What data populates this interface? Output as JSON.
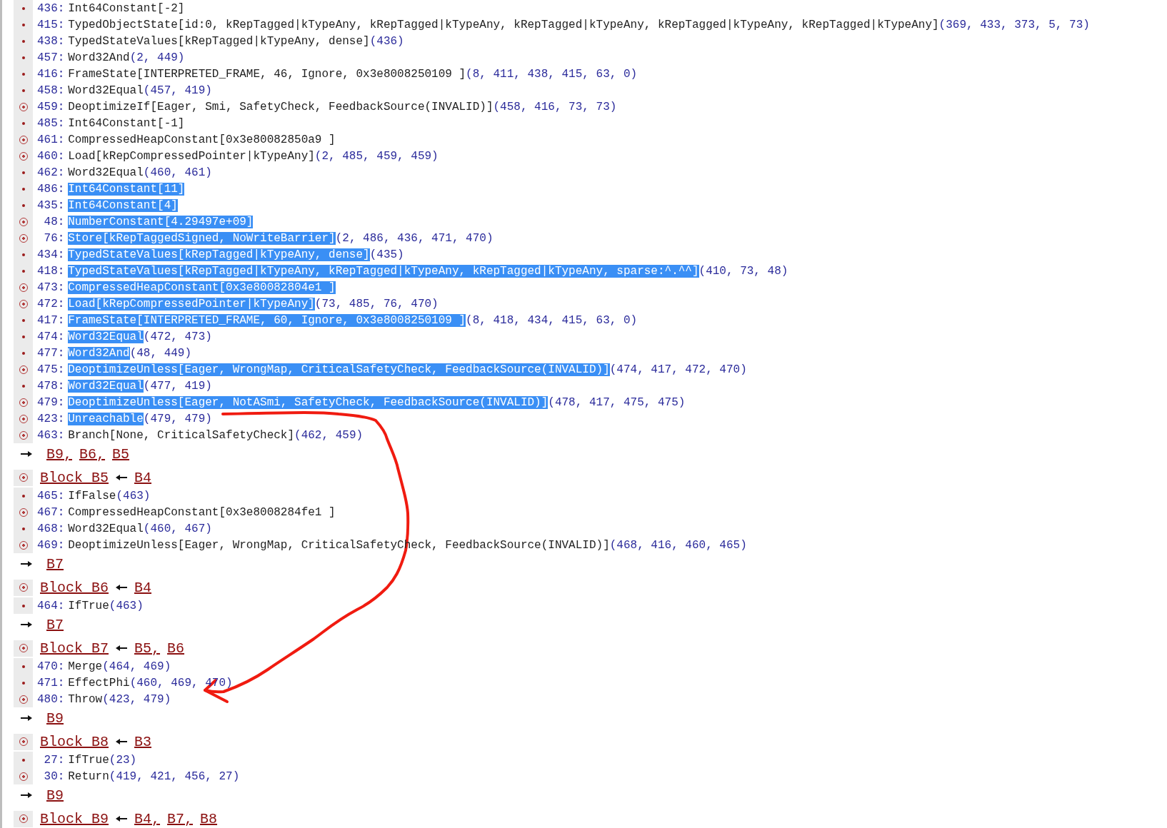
{
  "top_block": {
    "instructions": [
      {
        "id": "436:",
        "op": "Int64Constant[-2]",
        "kind": "dot",
        "selected": false
      },
      {
        "id": "415:",
        "op": "TypedObjectState[id:0, kRepTagged|kTypeAny, kRepTagged|kTypeAny, kRepTagged|kTypeAny, kRepTagged|kTypeAny, kRepTagged|kTypeAny]",
        "args": "(369, 433, 373, 5, 73)",
        "kind": "dot",
        "selected": false
      },
      {
        "id": "438:",
        "op": "TypedStateValues[kRepTagged|kTypeAny, dense]",
        "args": "(436)",
        "kind": "dot",
        "selected": false
      },
      {
        "id": "457:",
        "op": "Word32And",
        "args": "(2, 449)",
        "kind": "dot",
        "selected": false
      },
      {
        "id": "416:",
        "op": "FrameState[INTERPRETED_FRAME, 46, Ignore, 0x3e8008250109 ]",
        "args": "(8, 411, 438, 415, 63, 0)",
        "kind": "dot",
        "selected": false
      },
      {
        "id": "458:",
        "op": "Word32Equal",
        "args": "(457, 419)",
        "kind": "dot",
        "selected": false
      },
      {
        "id": "459:",
        "op": "DeoptimizeIf[Eager, Smi, SafetyCheck, FeedbackSource(INVALID)]",
        "args": "(458, 416, 73, 73)",
        "kind": "ring",
        "selected": false
      },
      {
        "id": "485:",
        "op": "Int64Constant[-1]",
        "kind": "dot",
        "selected": false
      },
      {
        "id": "461:",
        "op": "CompressedHeapConstant[0x3e80082850a9 ]",
        "kind": "ring",
        "selected": false
      },
      {
        "id": "460:",
        "op": "Load[kRepCompressedPointer|kTypeAny]",
        "args": "(2, 485, 459, 459)",
        "kind": "ring",
        "selected": false
      },
      {
        "id": "462:",
        "op": "Word32Equal",
        "args": "(460, 461)",
        "kind": "dot",
        "selected": false
      },
      {
        "id": "486:",
        "op": "Int64Constant[11]",
        "kind": "dot",
        "selected": true
      },
      {
        "id": "435:",
        "op": "Int64Constant[4]",
        "kind": "dot",
        "selected": true
      },
      {
        "id": "48:",
        "op": "NumberConstant[4.29497e+09]",
        "kind": "ring",
        "selected": true
      },
      {
        "id": "76:",
        "op": "Store[kRepTaggedSigned, NoWriteBarrier]",
        "args": "(2, 486, 436, 471, 470)",
        "kind": "ring",
        "selected": true
      },
      {
        "id": "434:",
        "op": "TypedStateValues[kRepTagged|kTypeAny, dense]",
        "args": "(435)",
        "kind": "dot",
        "selected": true
      },
      {
        "id": "418:",
        "op": "TypedStateValues[kRepTagged|kTypeAny, kRepTagged|kTypeAny, kRepTagged|kTypeAny, sparse:^.^^]",
        "args": "(410, 73, 48)",
        "kind": "dot",
        "selected": true
      },
      {
        "id": "473:",
        "op": "CompressedHeapConstant[0x3e80082804e1 ]",
        "kind": "ring",
        "selected": true
      },
      {
        "id": "472:",
        "op": "Load[kRepCompressedPointer|kTypeAny]",
        "args": "(73, 485, 76, 470)",
        "kind": "ring",
        "selected": true
      },
      {
        "id": "417:",
        "op": "FrameState[INTERPRETED_FRAME, 60, Ignore, 0x3e8008250109 ]",
        "args": "(8, 418, 434, 415, 63, 0)",
        "kind": "dot",
        "selected": true
      },
      {
        "id": "474:",
        "op": "Word32Equal",
        "args": "(472, 473)",
        "kind": "dot",
        "selected": true
      },
      {
        "id": "477:",
        "op": "Word32And",
        "args": "(48, 449)",
        "kind": "dot",
        "selected": true
      },
      {
        "id": "475:",
        "op": "DeoptimizeUnless[Eager, WrongMap, CriticalSafetyCheck, FeedbackSource(INVALID)]",
        "args": "(474, 417, 472, 470)",
        "kind": "ring",
        "selected": true
      },
      {
        "id": "478:",
        "op": "Word32Equal",
        "args": "(477, 419)",
        "kind": "dot",
        "selected": true
      },
      {
        "id": "479:",
        "op": "DeoptimizeUnless[Eager, NotASmi, SafetyCheck, FeedbackSource(INVALID)]",
        "args": "(478, 417, 475, 475)",
        "kind": "ring",
        "selected": true
      },
      {
        "id": "423:",
        "op": "Unreachable",
        "args": "(479, 479)",
        "kind": "ring",
        "selected": true
      },
      {
        "id": "463:",
        "op": "Branch[None, CriticalSafetyCheck]",
        "args": "(462, 459)",
        "kind": "ring",
        "selected": false
      }
    ],
    "successors": [
      "B9,",
      "B6,",
      "B5"
    ]
  },
  "blocks": [
    {
      "name": "Block B5",
      "predecessors": [
        "B4"
      ],
      "instructions": [
        {
          "id": "465:",
          "op": "IfFalse",
          "args": "(463)",
          "kind": "dot",
          "selected": false
        },
        {
          "id": "467:",
          "op": "CompressedHeapConstant[0x3e8008284fe1 ]",
          "kind": "ring",
          "selected": false
        },
        {
          "id": "468:",
          "op": "Word32Equal",
          "args": "(460, 467)",
          "kind": "dot",
          "selected": false
        },
        {
          "id": "469:",
          "op": "DeoptimizeUnless[Eager, WrongMap, CriticalSafetyCheck, FeedbackSource(INVALID)]",
          "args": "(468, 416, 460, 465)",
          "kind": "ring",
          "selected": false
        }
      ],
      "successors": [
        "B7"
      ]
    },
    {
      "name": "Block B6",
      "predecessors": [
        "B4"
      ],
      "instructions": [
        {
          "id": "464:",
          "op": "IfTrue",
          "args": "(463)",
          "kind": "dot",
          "selected": false
        }
      ],
      "successors": [
        "B7"
      ]
    },
    {
      "name": "Block B7",
      "predecessors": [
        "B5,",
        "B6"
      ],
      "instructions": [
        {
          "id": "470:",
          "op": "Merge",
          "args": "(464, 469)",
          "kind": "dot",
          "selected": false
        },
        {
          "id": "471:",
          "op": "EffectPhi",
          "args": "(460, 469, 470)",
          "kind": "dot",
          "selected": false
        },
        {
          "id": "480:",
          "op": "Throw",
          "args": "(423, 479)",
          "kind": "ring",
          "selected": false
        }
      ],
      "successors": [
        "B9"
      ]
    },
    {
      "name": "Block B8",
      "predecessors": [
        "B3"
      ],
      "instructions": [
        {
          "id": "27:",
          "op": "IfTrue",
          "args": "(23)",
          "kind": "dot",
          "selected": false
        },
        {
          "id": "30:",
          "op": "Return",
          "args": "(419, 421, 456, 27)",
          "kind": "ring",
          "selected": false
        }
      ],
      "successors": [
        "B9"
      ]
    },
    {
      "name": "Block B9",
      "predecessors": [
        "B4,",
        "B7,",
        "B8"
      ]
    }
  ]
}
